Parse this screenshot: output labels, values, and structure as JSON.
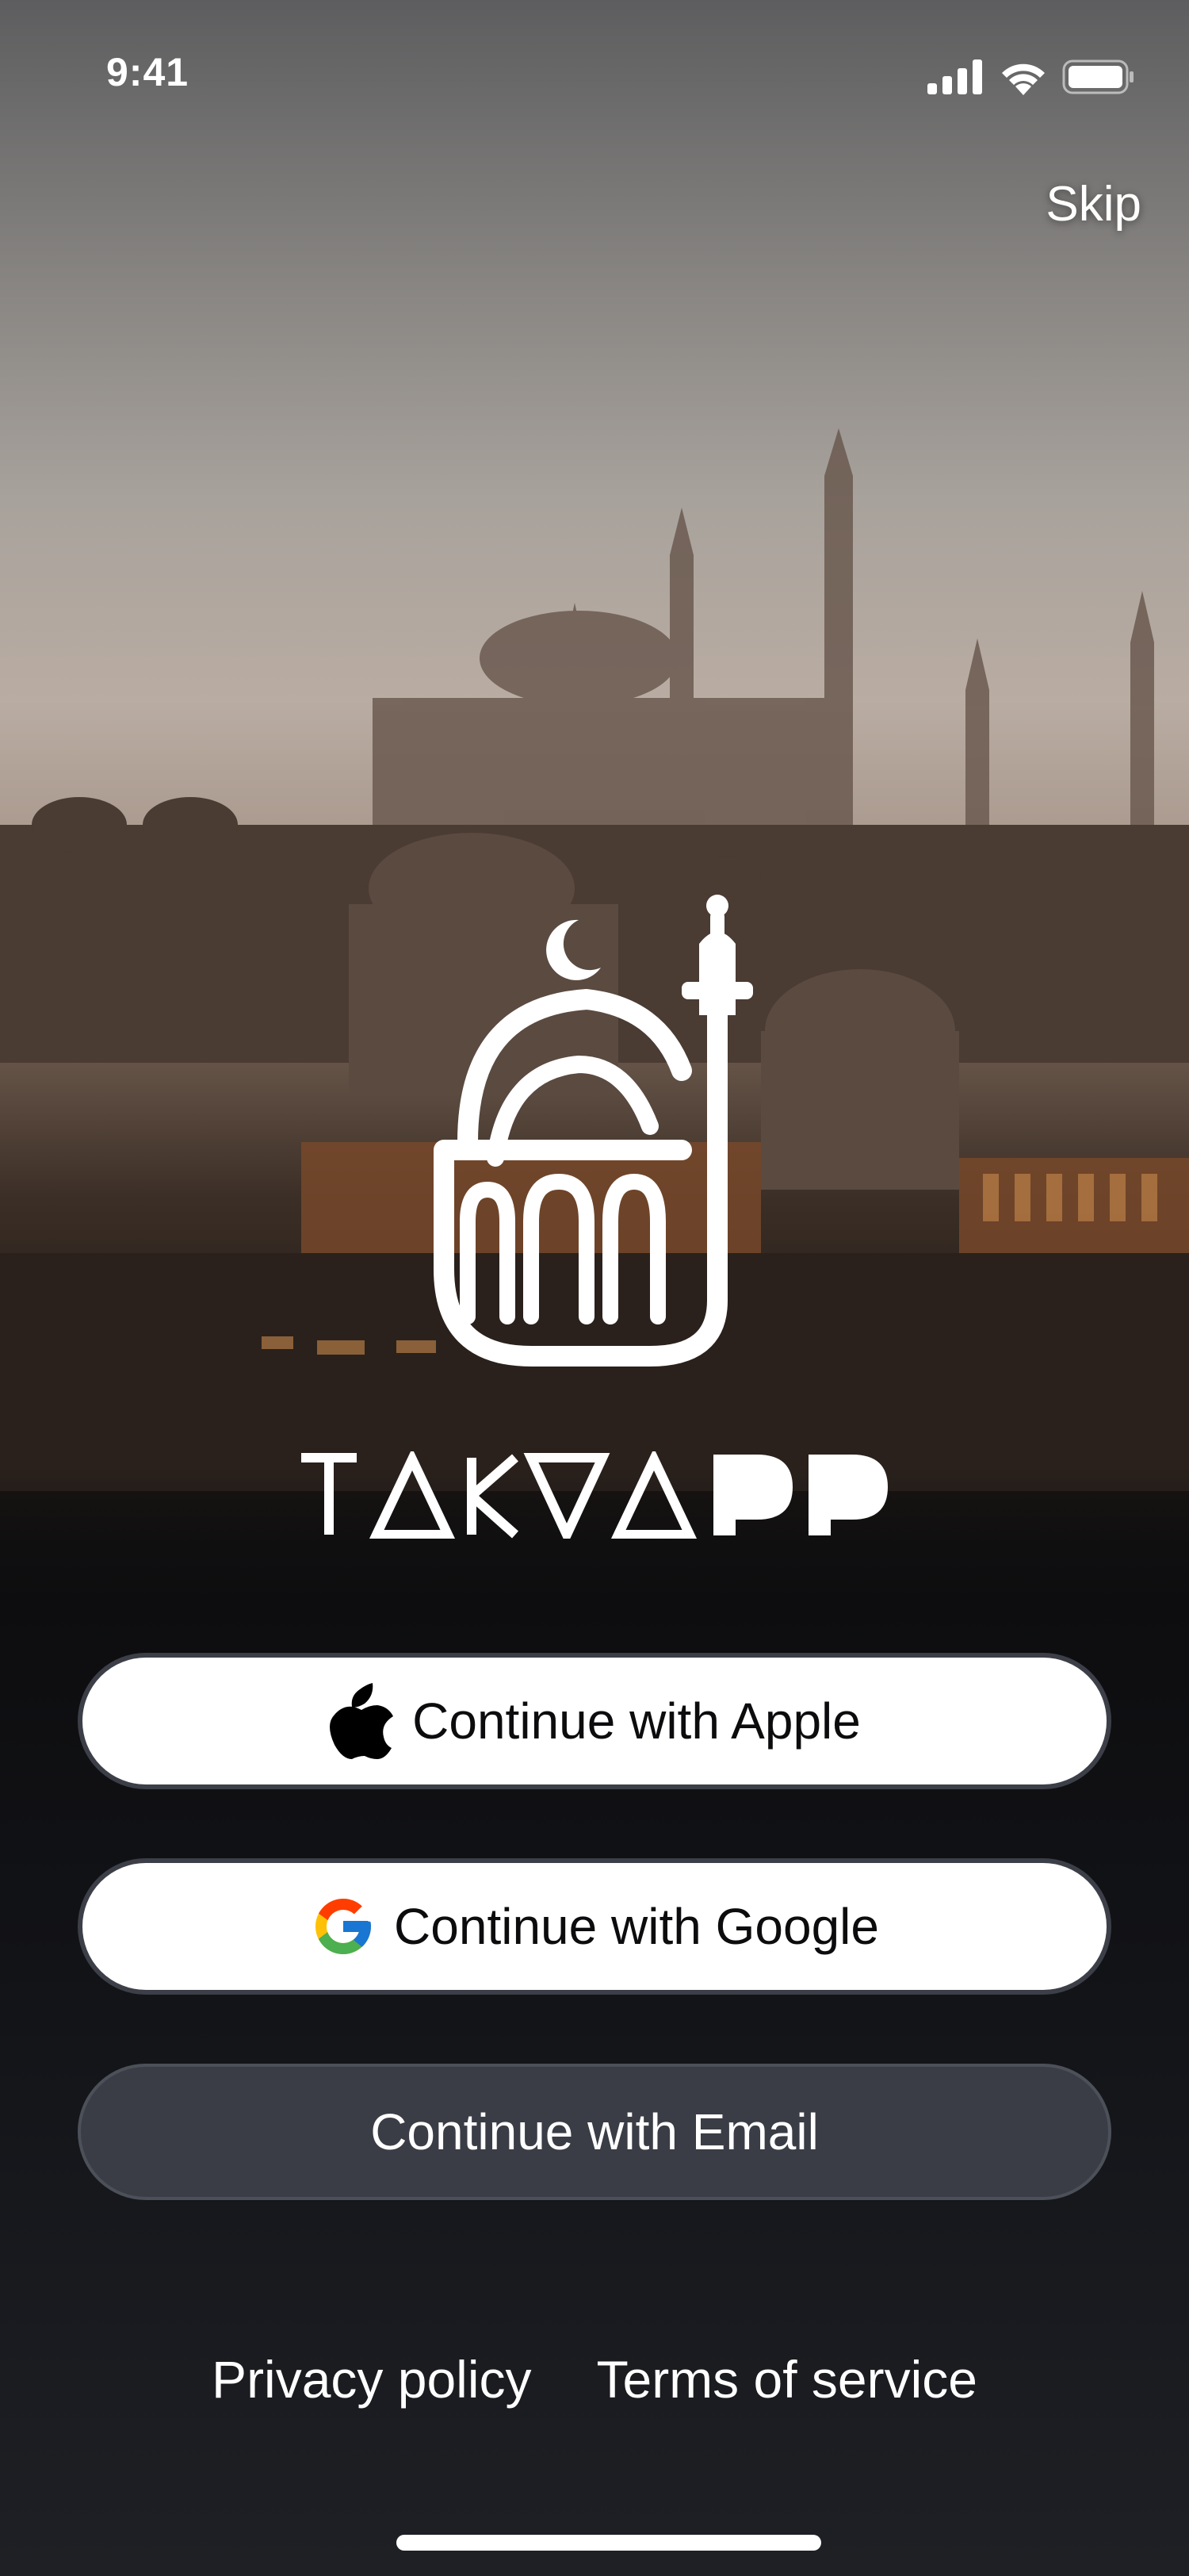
{
  "status_bar": {
    "time": "9:41"
  },
  "header": {
    "skip_label": "Skip"
  },
  "brand": {
    "name": "TAKVAPP"
  },
  "auth": {
    "apple_label": "Continue with Apple",
    "google_label": "Continue with Google",
    "email_label": "Continue with Email"
  },
  "footer": {
    "privacy_label": "Privacy policy",
    "terms_label": "Terms of service"
  },
  "icons": {
    "apple": "apple-logo-icon",
    "google": "google-logo-icon",
    "signal": "cellular-signal-icon",
    "wifi": "wifi-icon",
    "battery": "battery-icon"
  },
  "colors": {
    "primary_button_bg": "#ffffff",
    "secondary_button_bg": "#3a3d45",
    "background": "#16181c",
    "text_light": "#ffffff"
  }
}
